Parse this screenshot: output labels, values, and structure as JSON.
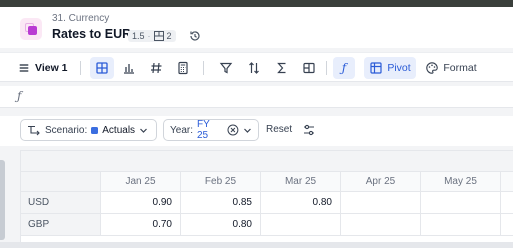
{
  "breadcrumb": "31. Currency",
  "title": "Rates to EUR",
  "meta": {
    "version": "1.5",
    "dimensions": "2"
  },
  "toolbar": {
    "view_label": "View 1",
    "pivot_label": "Pivot",
    "format_label": "Format"
  },
  "formula": {
    "fx_symbol": "ƒ"
  },
  "filters": {
    "scenario_label": "Scenario:",
    "scenario_value": "Actuals",
    "year_label": "Year:",
    "year_value": "FY 25",
    "reset_label": "Reset"
  },
  "grid": {
    "columns": [
      "Jan 25",
      "Feb 25",
      "Mar 25",
      "Apr 25",
      "May 25"
    ],
    "rows": [
      {
        "label": "USD",
        "values": [
          "0.90",
          "0.85",
          "0.80",
          "",
          ""
        ]
      },
      {
        "label": "GBP",
        "values": [
          "0.70",
          "0.80",
          "",
          "",
          ""
        ]
      }
    ]
  },
  "colors": {
    "accent": "#2a5bd7",
    "app_icon": "#b93bd3",
    "scenario_dot": "#3b6ee0"
  }
}
